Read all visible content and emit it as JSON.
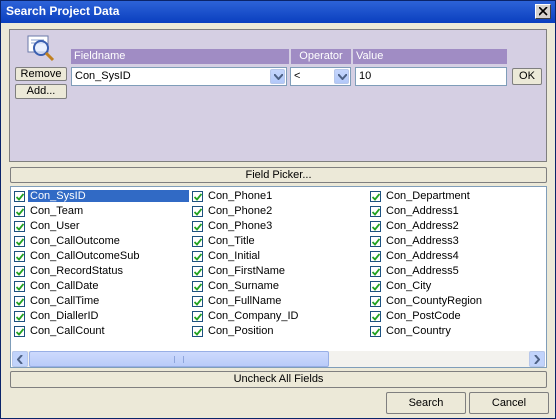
{
  "window": {
    "title": "Search Project Data"
  },
  "criteria": {
    "headers": {
      "fieldname": "Fieldname",
      "operator": "Operator",
      "value": "Value"
    },
    "remove_label": "Remove",
    "add_label": "Add...",
    "field_value": "Con_SysID",
    "operator_value": "<",
    "value_value": "10",
    "ok_label": "OK"
  },
  "field_picker_label": "Field Picker...",
  "fields": {
    "col1": [
      "Con_SysID",
      "Con_Team",
      "Con_User",
      "Con_CallOutcome",
      "Con_CallOutcomeSub",
      "Con_RecordStatus",
      "Con_CallDate",
      "Con_CallTime",
      "Con_DiallerID",
      "Con_CallCount"
    ],
    "col2": [
      "Con_Phone1",
      "Con_Phone2",
      "Con_Phone3",
      "Con_Title",
      "Con_Initial",
      "Con_FirstName",
      "Con_Surname",
      "Con_FullName",
      "Con_Company_ID",
      "Con_Position"
    ],
    "col3": [
      "Con_Department",
      "Con_Address1",
      "Con_Address2",
      "Con_Address3",
      "Con_Address4",
      "Con_Address5",
      "Con_City",
      "Con_CountyRegion",
      "Con_PostCode",
      "Con_Country"
    ]
  },
  "uncheck_label": "Uncheck All Fields",
  "search_label": "Search",
  "cancel_label": "Cancel"
}
